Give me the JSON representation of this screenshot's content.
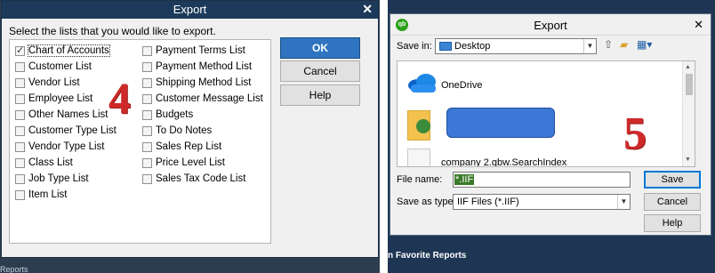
{
  "left_dialog": {
    "title": "Export",
    "close_glyph": "✕",
    "instruction": "Select the lists that you would like to export.",
    "col1": [
      {
        "label": "Chart of Accounts",
        "checked": true
      },
      {
        "label": "Customer List",
        "checked": false
      },
      {
        "label": "Vendor List",
        "checked": false
      },
      {
        "label": "Employee List",
        "checked": false
      },
      {
        "label": "Other Names List",
        "checked": false
      },
      {
        "label": "Customer Type List",
        "checked": false
      },
      {
        "label": "Vendor Type List",
        "checked": false
      },
      {
        "label": "Class List",
        "checked": false
      },
      {
        "label": "Job Type List",
        "checked": false
      },
      {
        "label": "Item List",
        "checked": false
      }
    ],
    "col2": [
      {
        "label": "Payment Terms List",
        "checked": false
      },
      {
        "label": "Payment Method List",
        "checked": false
      },
      {
        "label": "Shipping Method List",
        "checked": false
      },
      {
        "label": "Customer Message List",
        "checked": false
      },
      {
        "label": "Budgets",
        "checked": false
      },
      {
        "label": "To Do Notes",
        "checked": false
      },
      {
        "label": "Sales Rep List",
        "checked": false
      },
      {
        "label": "Price Level List",
        "checked": false
      },
      {
        "label": "Sales Tax Code List",
        "checked": false
      }
    ],
    "buttons": {
      "ok": "OK",
      "cancel": "Cancel",
      "help": "Help"
    },
    "step_number": "4",
    "background_text": "Reports"
  },
  "right_dialog": {
    "title": "Export",
    "close_glyph": "✕",
    "logo_text": "qb",
    "save_in_label": "Save in:",
    "save_in_value": "Desktop",
    "files": [
      {
        "name": "OneDrive"
      },
      {
        "name": "company 2.qbw.SearchIndex"
      }
    ],
    "file_name_label": "File name:",
    "file_name_value": "*.IIF",
    "save_as_type_label": "Save as type:",
    "save_as_type_value": "IIF Files (*.IIF)",
    "buttons": {
      "save": "Save",
      "cancel": "Cancel",
      "help": "Help"
    },
    "step_number": "5",
    "background_text": "n Favorite Reports"
  },
  "colors": {
    "titlebar_left": "#1d3a5a",
    "ok_button": "#2f74c0",
    "step_number": "#cf2a2a",
    "redaction": "#3e78d6",
    "filename_highlight": "#3a7a2a"
  }
}
